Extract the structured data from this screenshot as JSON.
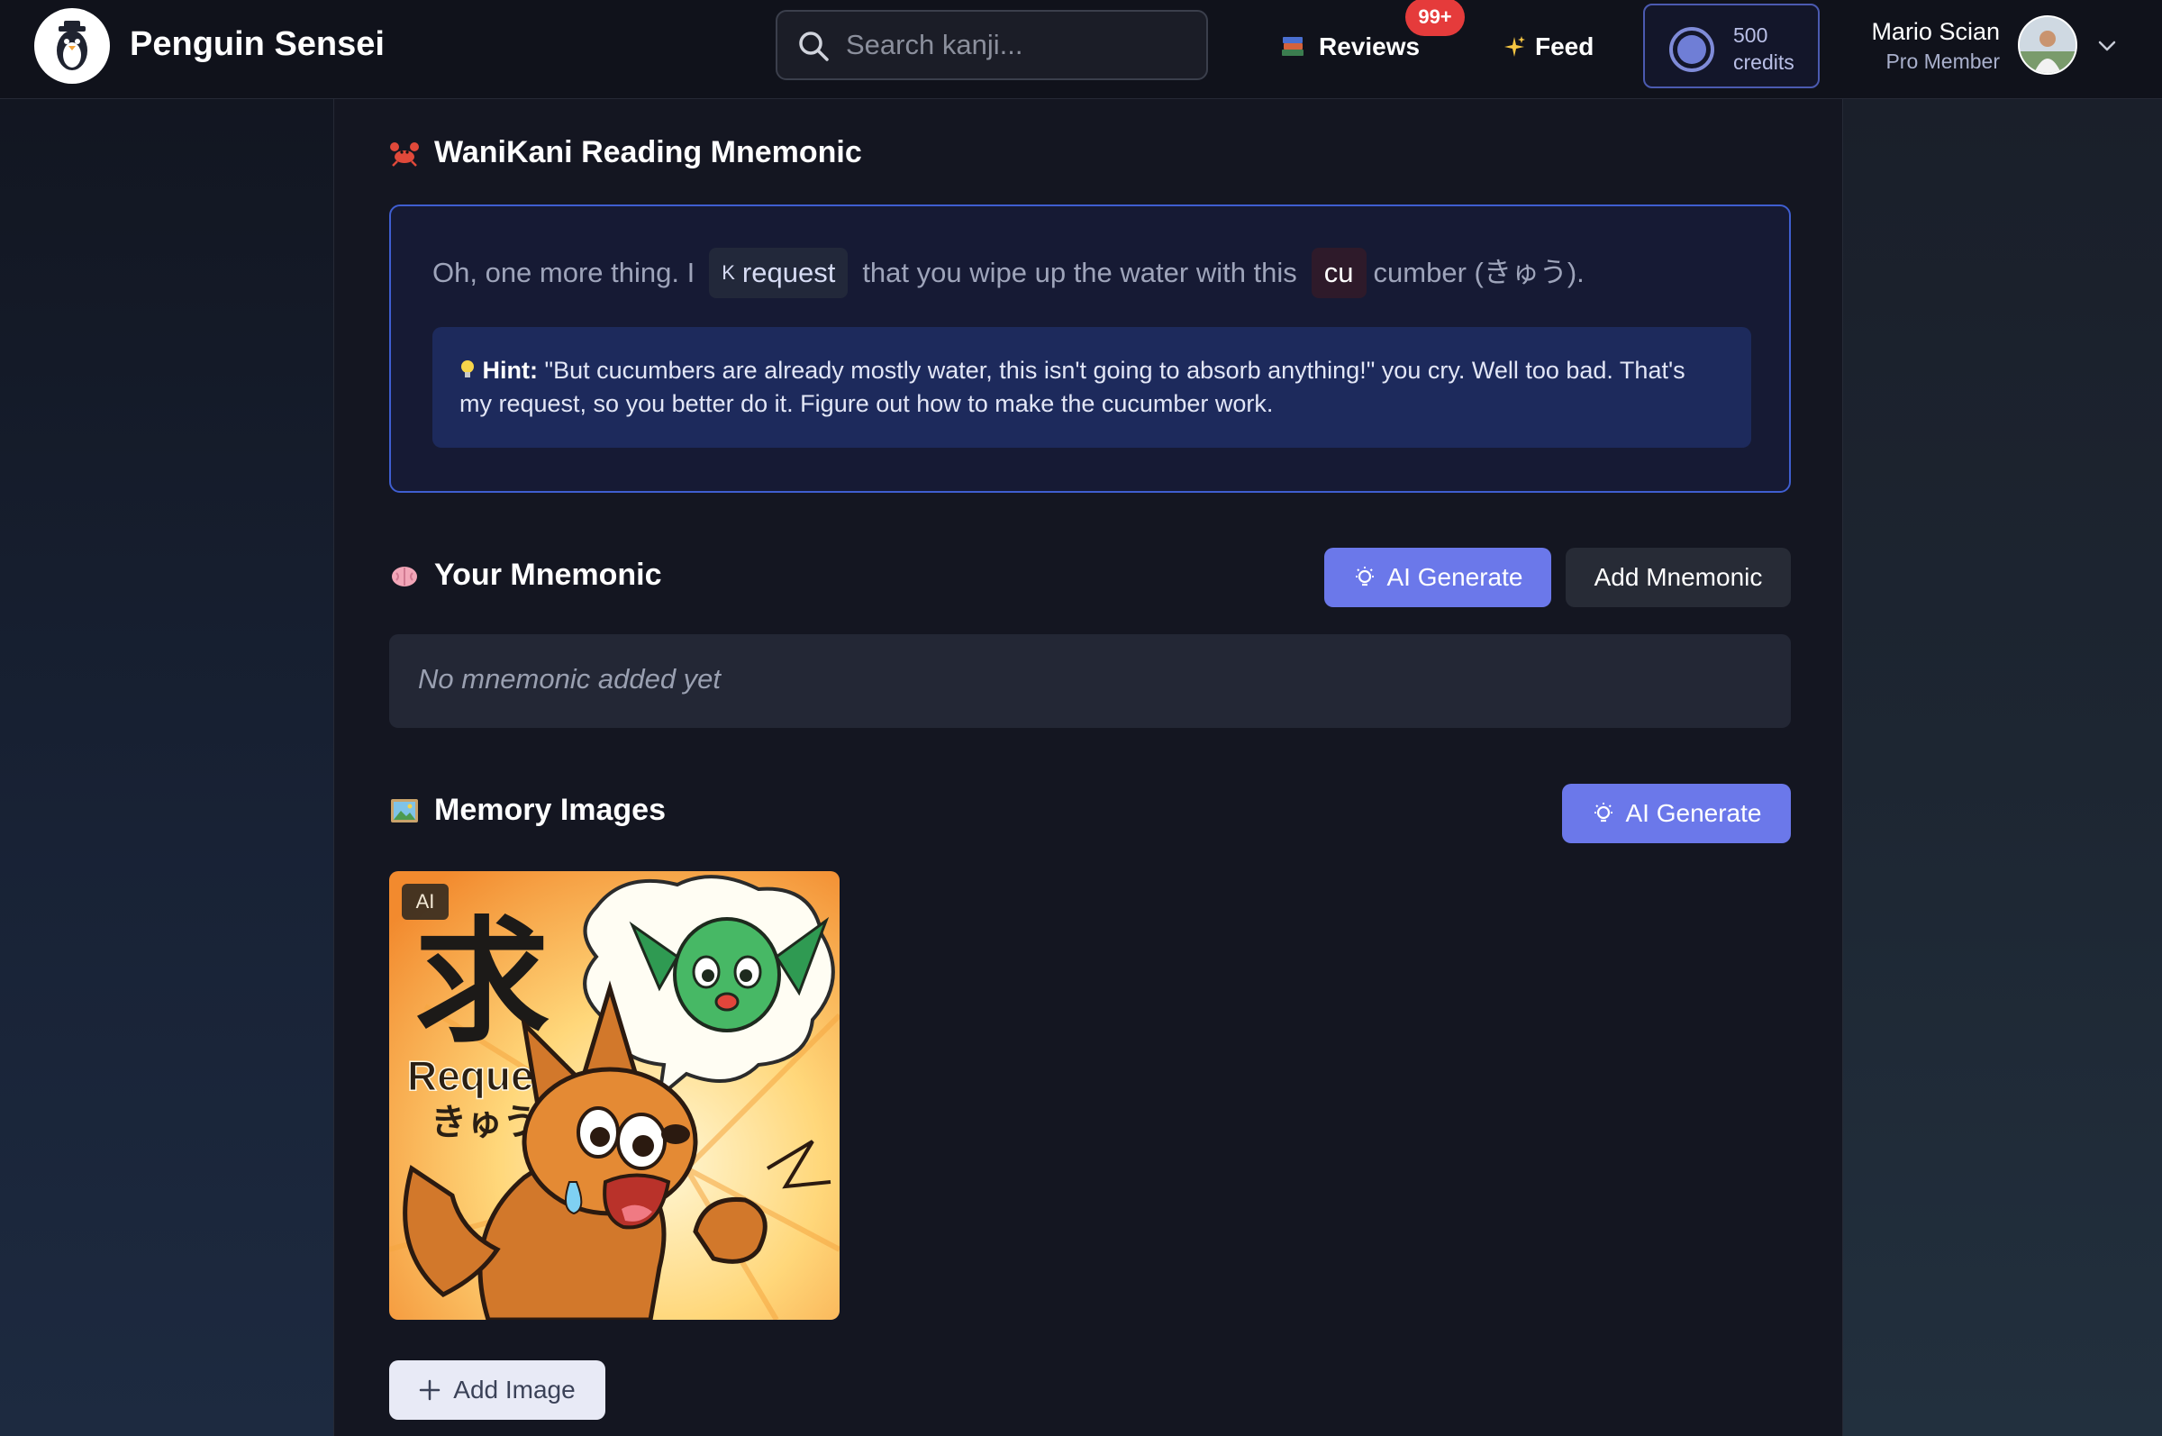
{
  "header": {
    "brand": "Penguin Sensei",
    "search_placeholder": "Search kanji...",
    "reviews_label": "Reviews",
    "reviews_badge": "99+",
    "feed_label": "Feed",
    "credits_amount": "500",
    "credits_unit": "credits",
    "user_name": "Mario Scian",
    "user_role": "Pro Member"
  },
  "wanikani": {
    "title": "WaniKani Reading Mnemonic",
    "text_before": "Oh, one more thing. I",
    "chip_kana": "K",
    "chip_request": "request",
    "text_middle": "that you wipe up the water with this",
    "chip_cu": "cu",
    "text_after": "cumber (きゅう).",
    "hint_label": "Hint:",
    "hint_text": "\"But cucumbers are already mostly water, this isn't going to absorb anything!\" you cry. Well too bad. That's my request, so you better do it. Figure out how to make the cucumber work."
  },
  "your_mnemonic": {
    "title": "Your Mnemonic",
    "ai_generate_label": "AI Generate",
    "add_label": "Add Mnemonic",
    "empty_text": "No mnemonic added yet"
  },
  "memory_images": {
    "title": "Memory Images",
    "ai_generate_label": "AI Generate",
    "image_tag": "AI",
    "image_kanji": "求",
    "image_caption": "Request",
    "image_reading": "きゅう",
    "add_image_label": "Add Image"
  },
  "colors": {
    "accent": "#6b78ea",
    "badge": "#e53b3b",
    "wk_border": "#3f5ed0",
    "hint_bg": "#1d2a5c"
  }
}
